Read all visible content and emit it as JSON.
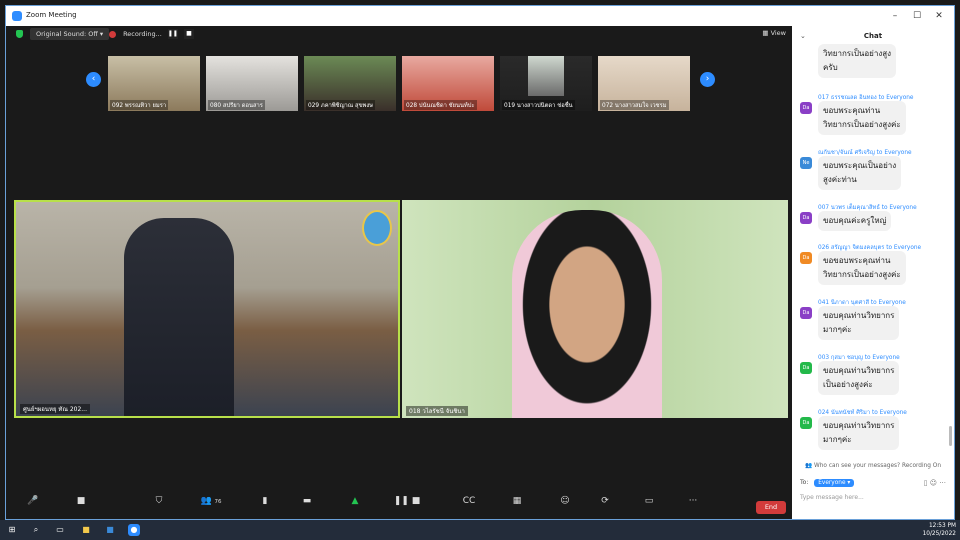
{
  "window": {
    "title": "Zoom Meeting",
    "controls": [
      "–",
      "☐",
      "✕"
    ]
  },
  "topbar": {
    "sound_label": "Original Sound: Off",
    "recording_label": "Recording...",
    "view_label": "View"
  },
  "thumbnails": [
    "092 พรรณทิวา ยมรา",
    "080 สปรียา ดอนสาร",
    "029 ภคาพิชิญาณ สุขพงษ",
    "028 ปนันณชิดา ชัยนนท์ปะ",
    "019 นางสาวปนิตดา ช่อชื่น",
    "072 นางสาวสมใจ เวชรม"
  ],
  "videos": {
    "left_label": "ศูนย์ฯผอนหยุ ทัณ 202...",
    "right_label": "018 วไลรัชนี จันชินา"
  },
  "chat": {
    "header": "Chat",
    "messages": [
      {
        "meta": "",
        "to": "",
        "avatar": "",
        "text": [
          "วิทยากรเป็นอย่างสูง",
          "ครับ"
        ]
      },
      {
        "meta": "017 ธรรชณลด อินทอง",
        "to": "to Everyone",
        "avatar": "Da",
        "text": [
          "ขอบพระคุณท่าน",
          "วิทยากรเป็นอย่างสูงค่ะ"
        ]
      },
      {
        "meta": "ณกันชา/จันณ์ ศรีเจริญ",
        "to": "to Everyone",
        "avatar": "Ne",
        "text": [
          "ขอบพระคุณเป็นอย่าง",
          "สูงค่ะท่าน"
        ]
      },
      {
        "meta": "007 นวพร เต็มคุณาสิทธ์",
        "to": "to Everyone",
        "avatar": "Da",
        "text": [
          "ขอบคุณค่ะครูใหญ่"
        ]
      },
      {
        "meta": "026 สรัญญา จิตมงคลบุตร",
        "to": "to Everyone",
        "avatar": "Da",
        "text": [
          "ขอขอบพระคุณท่าน",
          "วิทยากรเป็นอย่างสูงค่ะ"
        ]
      },
      {
        "meta": "041 นิภาดา นุตศาสี",
        "to": "to Everyone",
        "avatar": "Da",
        "text": [
          "ขอบคุณท่านวิทยากร",
          "มากๆค่ะ"
        ]
      },
      {
        "meta": "003 กุสมา ชอบุญ",
        "to": "to Everyone",
        "avatar": "Da",
        "text": [
          "ขอบคุณท่านวิทยากร",
          "เป็นอย่างสูงค่ะ"
        ]
      },
      {
        "meta": "024 นันทนัชท์ ศิริมา",
        "to": "to Everyone",
        "avatar": "Da",
        "text": [
          "ขอบคุณท่านวิทยากร",
          "มากๆค่ะ"
        ]
      }
    ],
    "notice": "Who can see your messages? Recording On",
    "to_label": "To:",
    "to_value": "Everyone",
    "placeholder": "Type message here..."
  },
  "toolbar": {
    "participants_count": "76",
    "end_label": "End"
  },
  "taskbar": {
    "time": "12:53 PM",
    "date": "10/25/2022"
  },
  "colors": {
    "accent": "#2d8cff",
    "end": "#d23b3b",
    "shield": "#23c552"
  }
}
